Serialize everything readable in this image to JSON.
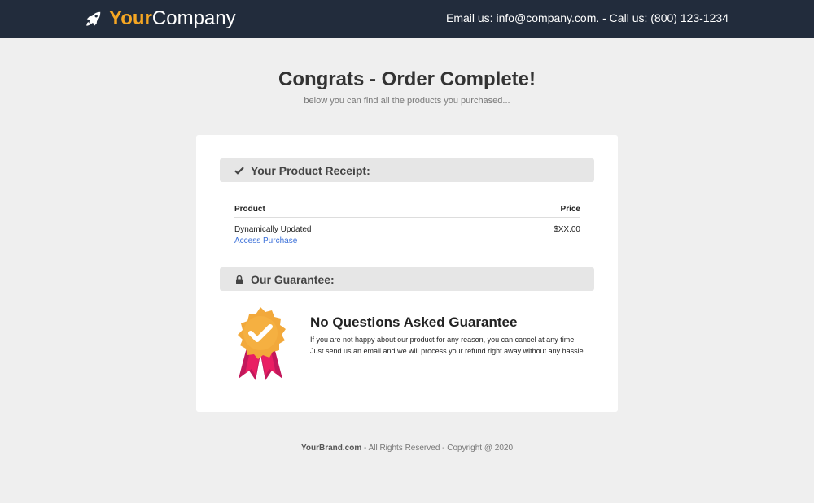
{
  "header": {
    "logo_accent": "Your",
    "logo_rest": "Company",
    "logo_icon": "rocket-icon",
    "contact": "Email us: info@company.com.  -  Call us: (800) 123-1234"
  },
  "main": {
    "headline": "Congrats - Order Complete!",
    "subline": "below you can find all the products you purchased..."
  },
  "receipt": {
    "title": "Your Product Receipt:",
    "icon": "checkmark-icon",
    "columns": {
      "product": "Product",
      "price": "Price"
    },
    "rows": [
      {
        "product": "Dynamically Updated",
        "link": "Access Purchase",
        "price": "$XX.00"
      }
    ]
  },
  "guarantee": {
    "title": "Our Guarantee:",
    "icon": "lock-icon",
    "badge_icon": "award-badge-icon",
    "heading": "No Questions Asked Guarantee",
    "text": "If you are not happy about our product for any reason, you can cancel at any time. Just send us an email and we will process your refund right away without any hassle..."
  },
  "footer": {
    "brand": "YourBrand.com",
    "rest": " - All Rights Reserved - Copyright @ 2020"
  },
  "colors": {
    "topbar": "#222c3c",
    "accent": "#f5a623",
    "link": "#3a6fd8",
    "badge_gold": "#f2a93b",
    "ribbon": "#d81b60"
  }
}
